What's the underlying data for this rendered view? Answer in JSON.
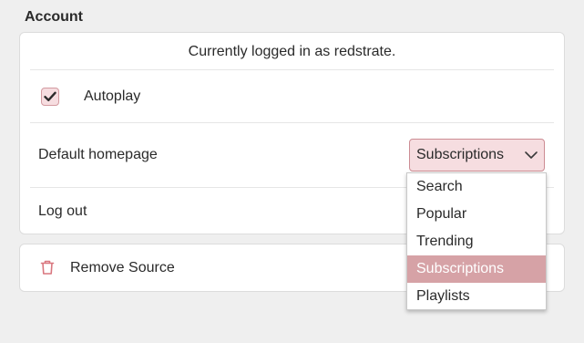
{
  "section": {
    "title": "Account"
  },
  "account": {
    "login_status": "Currently logged in as redstrate.",
    "autoplay": {
      "label": "Autoplay",
      "checked": true
    },
    "default_homepage": {
      "label": "Default homepage",
      "selected": "Subscriptions",
      "options": [
        {
          "label": "Search",
          "selected": false
        },
        {
          "label": "Popular",
          "selected": false
        },
        {
          "label": "Trending",
          "selected": false
        },
        {
          "label": "Subscriptions",
          "selected": true
        },
        {
          "label": "Playlists",
          "selected": false
        }
      ]
    },
    "logout_label": "Log out"
  },
  "source": {
    "remove_label": "Remove Source"
  },
  "icons": {
    "checkbox": "checkmark-icon",
    "select": "chevron-down-icon",
    "remove": "trash-icon"
  },
  "colors": {
    "accent": "#d6a2a6",
    "accent_light": "#f6dde0",
    "accent_border": "#cc8c93",
    "danger_icon": "#d9777f",
    "background": "#efefef",
    "card": "#ffffff"
  }
}
